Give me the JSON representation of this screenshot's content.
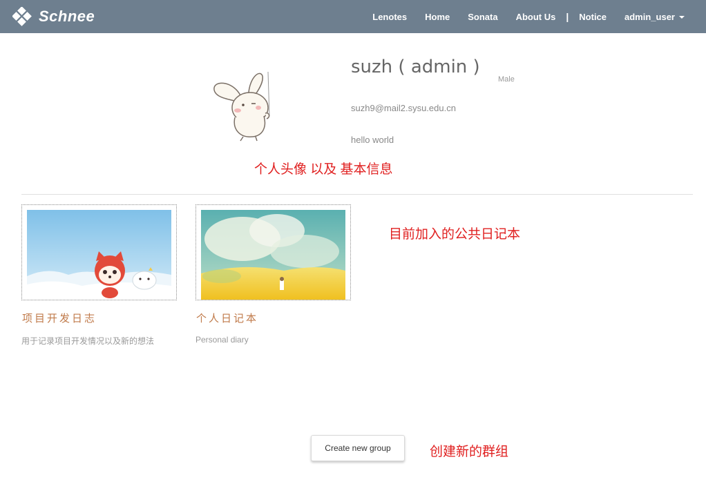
{
  "navbar": {
    "brand": "Schnee",
    "links": [
      "Lenotes",
      "Home",
      "Sonata",
      "About Us"
    ],
    "separator": "|",
    "notice": "Notice",
    "user": "admin_user",
    "background_color": "#6e7f8f"
  },
  "profile": {
    "avatar_icon": "bunny-avatar",
    "name": "suzh ( admin )",
    "gender": "Male",
    "email": "suzh9@mail2.sysu.edu.cn",
    "motto": "hello world"
  },
  "annotations": {
    "profile_note": "个人头像 以及 基本信息",
    "notebooks_note": "目前加入的公共日记本",
    "create_note": "创建新的群组",
    "color": "#e02020"
  },
  "notebooks": [
    {
      "title": "项目开发日志",
      "description": "用于记录项目开发情况以及新的想法",
      "cover_icon": "cartoon-fox-cover"
    },
    {
      "title": "个人日记本",
      "description": "Personal diary",
      "cover_icon": "field-landscape-cover"
    }
  ],
  "actions": {
    "create_group": "Create new group"
  }
}
